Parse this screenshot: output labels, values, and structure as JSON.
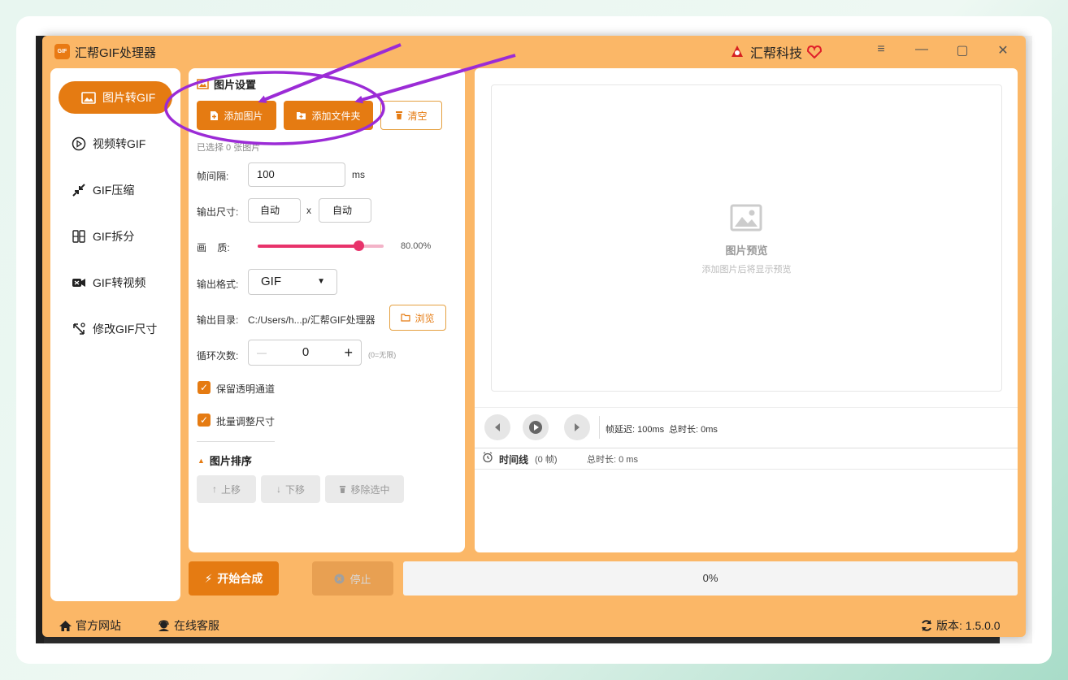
{
  "app": {
    "logo_text": "GIF",
    "title": "汇帮GIF处理器",
    "brand": "汇帮科技"
  },
  "window_controls": {
    "menu": "≡",
    "minimize": "—",
    "maximize": "▢",
    "close": "✕"
  },
  "sidebar": {
    "items": [
      {
        "label": "图片转GIF",
        "icon": "image-icon",
        "active": true
      },
      {
        "label": "视频转GIF",
        "icon": "play-circle-icon",
        "active": false
      },
      {
        "label": "GIF压缩",
        "icon": "compress-icon",
        "active": false
      },
      {
        "label": "GIF拆分",
        "icon": "split-icon",
        "active": false
      },
      {
        "label": "GIF转视频",
        "icon": "video-icon",
        "active": false
      },
      {
        "label": "修改GIF尺寸",
        "icon": "resize-icon",
        "active": false
      }
    ]
  },
  "settings": {
    "section_title": "图片设置",
    "add_image": "添加图片",
    "add_folder": "添加文件夹",
    "clear": "清空",
    "selected_info": "已选择 0 张图片",
    "frame_interval_label": "帧间隔:",
    "frame_interval_value": "100",
    "frame_interval_unit": "ms",
    "output_size_label": "输出尺寸:",
    "width_value": "自动",
    "size_sep": "x",
    "height_value": "自动",
    "quality_label": "画    质:",
    "quality_value": "80.00%",
    "quality_fraction": 0.8,
    "format_label": "输出格式:",
    "format_value": "GIF",
    "output_dir_label": "输出目录:",
    "output_dir_value": "C:/Users/h...p/汇帮GIF处理器",
    "browse": "浏览",
    "loop_label": "循环次数:",
    "loop_value": "0",
    "loop_minus": "—",
    "loop_plus": "+",
    "loop_hint": "(0=无限)",
    "keep_alpha": "保留透明通道",
    "batch_resize": "批量调整尺寸",
    "sort_title": "图片排序",
    "move_up": "上移",
    "move_down": "下移",
    "remove_selected": "移除选中"
  },
  "preview": {
    "title": "图片预览",
    "hint": "添加图片后将显示预览",
    "frame_delay": "帧延迟: 100ms",
    "total_duration": "总时长: 0ms",
    "timeline_label": "时间线",
    "timeline_frames": "(0 帧)",
    "timeline_total": "总时长: 0 ms"
  },
  "actions": {
    "start": "开始合成",
    "stop": "停止",
    "progress_text": "0%",
    "progress_fraction": 0
  },
  "footer": {
    "website": "官方网站",
    "support": "在线客服",
    "version": "版本:  1.5.0.0"
  },
  "colors": {
    "accent": "#e57b12",
    "window_bg": "#fbb767",
    "slider": "#e8336b",
    "annotation": "#9b2bd6"
  }
}
